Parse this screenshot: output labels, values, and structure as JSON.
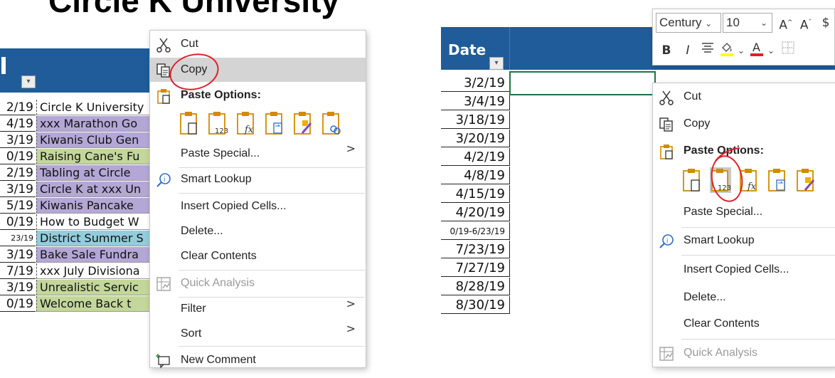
{
  "left_sheet": {
    "title": "Circle K University",
    "rows": [
      {
        "date": "2/19",
        "event": "Circle K University",
        "color": "#ffffff"
      },
      {
        "date": "4/19",
        "event": "xxx Marathon Go",
        "color": "#b4a7d6"
      },
      {
        "date": "3/19",
        "event": "Kiwanis Club Gen",
        "color": "#b4a7d6"
      },
      {
        "date": "0/19",
        "event": "Raising Cane's Fu",
        "color": "#c4d79b"
      },
      {
        "date": "2/19",
        "event": "Tabling at Circle",
        "color": "#b4a7d6"
      },
      {
        "date": "3/19",
        "event": "Circle K at xxx Un",
        "color": "#b4a7d6"
      },
      {
        "date": "5/19",
        "event": "Kiwanis Pancake",
        "color": "#b4a7d6"
      },
      {
        "date": "0/19",
        "event": "How to Budget W",
        "color": "#ffffff"
      },
      {
        "date": "23/19",
        "event": "District Summer S",
        "color": "#92cddc"
      },
      {
        "date": "3/19",
        "event": "Bake Sale Fundra",
        "color": "#b4a7d6"
      },
      {
        "date": "7/19",
        "event": "xxx July Divisiona",
        "color": "#ffffff"
      },
      {
        "date": "3/19",
        "event": "Unrealistic Servic",
        "color": "#c4d79b"
      },
      {
        "date": "0/19",
        "event": "Welcome Back t",
        "color": "#c4d79b"
      }
    ],
    "menu": {
      "cut": "Cut",
      "copy": "Copy",
      "paste_options": "Paste Options:",
      "paste_special": "Paste Special...",
      "smart_lookup": "Smart Lookup",
      "insert_copied_cells": "Insert Copied Cells...",
      "delete": "Delete...",
      "clear_contents": "Clear Contents",
      "quick_analysis": "Quick Analysis",
      "filter": "Filter",
      "sort": "Sort",
      "new_comment": "New Comment"
    }
  },
  "right_sheet": {
    "header": "Date",
    "dates": [
      "3/2/19",
      "3/4/19",
      "3/18/19",
      "3/20/19",
      "4/2/19",
      "4/8/19",
      "4/15/19",
      "4/20/19",
      "0/19-6/23/19",
      "7/23/19",
      "7/27/19",
      "8/28/19",
      "8/30/19"
    ],
    "toolbar": {
      "font": "Century",
      "size": "10",
      "bold": "B",
      "italic": "I",
      "increase_font": "A",
      "decrease_font": "A",
      "currency": "$"
    },
    "menu": {
      "cut": "Cut",
      "copy": "Copy",
      "paste_options": "Paste Options:",
      "paste_special": "Paste Special...",
      "smart_lookup": "Smart Lookup",
      "insert_copied_cells": "Insert Copied Cells...",
      "delete": "Delete...",
      "clear_contents": "Clear Contents",
      "quick_analysis": "Quick Analysis"
    }
  },
  "colors": {
    "header_blue": "#1f5c99",
    "annotation_red": "#e0202a",
    "selection_green": "#217346",
    "menu_highlight": "#d4d4d4"
  }
}
